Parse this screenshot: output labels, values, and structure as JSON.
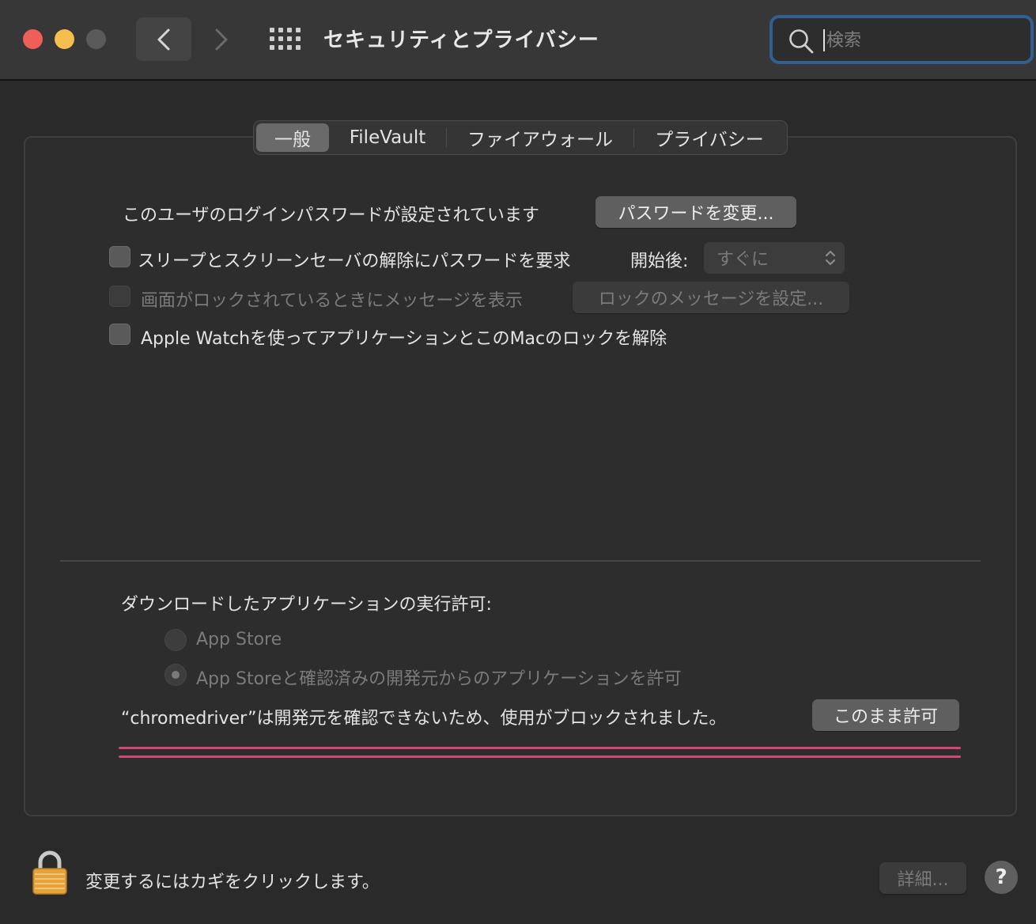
{
  "window": {
    "title": "セキュリティとプライバシー",
    "search_placeholder": "検索"
  },
  "tabs": [
    {
      "label": "一般",
      "active": true
    },
    {
      "label": "FileVault",
      "active": false
    },
    {
      "label": "ファイアウォール",
      "active": false
    },
    {
      "label": "プライバシー",
      "active": false
    }
  ],
  "general": {
    "password_set_text": "このユーザのログインパスワードが設定されています",
    "change_password_button": "パスワードを変更...",
    "require_password_label": "スリープとスクリーンセーバの解除にパスワードを要求",
    "require_password_checked": false,
    "start_after_label": "開始後:",
    "start_after_value": "すぐに",
    "show_message_label": "画面がロックされているときにメッセージを表示",
    "show_message_checked": false,
    "set_lock_message_button": "ロックのメッセージを設定...",
    "apple_watch_label": "Apple Watchを使ってアプリケーションとこのMacのロックを解除",
    "apple_watch_checked": false
  },
  "downloads": {
    "heading": "ダウンロードしたアプリケーションの実行許可:",
    "option_app_store": "App Store",
    "option_app_store_identified": "App Storeと確認済みの開発元からのアプリケーションを許可",
    "selected": "option_app_store_identified",
    "blocked_message": "“chromedriver”は開発元を確認できないため、使用がブロックされました。",
    "allow_anyway_button": "このまま許可"
  },
  "footer": {
    "lock_text": "変更するにはカギをクリックします。",
    "advanced_button": "詳細...",
    "help_label": "?"
  },
  "colors": {
    "accent_focus": "#2f5f93",
    "highlight_underline": "#cc4a78",
    "close": "#ed5f57",
    "minimize": "#f5bf4f"
  }
}
